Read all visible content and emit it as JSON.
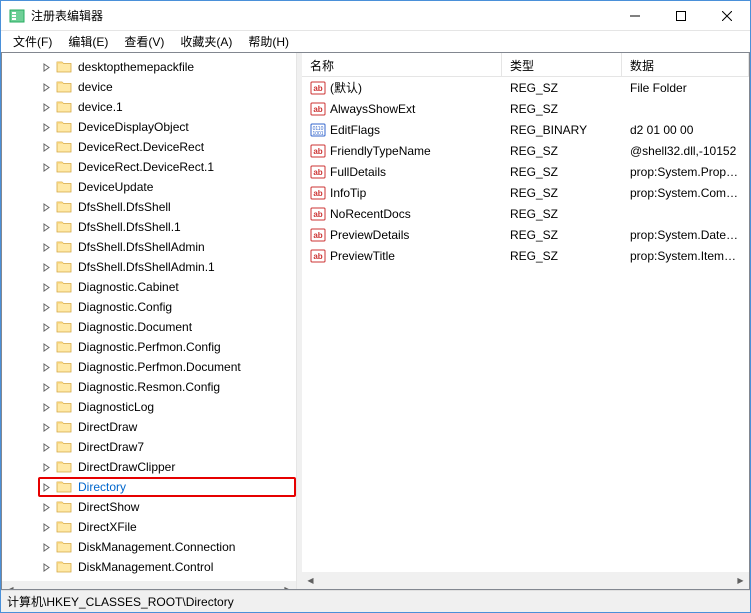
{
  "window": {
    "title": "注册表编辑器"
  },
  "menu": {
    "file": "文件(F)",
    "edit": "编辑(E)",
    "view": "查看(V)",
    "favorites": "收藏夹(A)",
    "help": "帮助(H)"
  },
  "tree": {
    "items": [
      {
        "label": "desktopthemepackfile",
        "expandable": true
      },
      {
        "label": "device",
        "expandable": true
      },
      {
        "label": "device.1",
        "expandable": true
      },
      {
        "label": "DeviceDisplayObject",
        "expandable": true
      },
      {
        "label": "DeviceRect.DeviceRect",
        "expandable": true
      },
      {
        "label": "DeviceRect.DeviceRect.1",
        "expandable": true
      },
      {
        "label": "DeviceUpdate",
        "expandable": false
      },
      {
        "label": "DfsShell.DfsShell",
        "expandable": true
      },
      {
        "label": "DfsShell.DfsShell.1",
        "expandable": true
      },
      {
        "label": "DfsShell.DfsShellAdmin",
        "expandable": true
      },
      {
        "label": "DfsShell.DfsShellAdmin.1",
        "expandable": true
      },
      {
        "label": "Diagnostic.Cabinet",
        "expandable": true
      },
      {
        "label": "Diagnostic.Config",
        "expandable": true
      },
      {
        "label": "Diagnostic.Document",
        "expandable": true
      },
      {
        "label": "Diagnostic.Perfmon.Config",
        "expandable": true
      },
      {
        "label": "Diagnostic.Perfmon.Document",
        "expandable": true
      },
      {
        "label": "Diagnostic.Resmon.Config",
        "expandable": true
      },
      {
        "label": "DiagnosticLog",
        "expandable": true
      },
      {
        "label": "DirectDraw",
        "expandable": true
      },
      {
        "label": "DirectDraw7",
        "expandable": true
      },
      {
        "label": "DirectDrawClipper",
        "expandable": true
      },
      {
        "label": "Directory",
        "expandable": true,
        "selected": true,
        "highlighted": true
      },
      {
        "label": "DirectShow",
        "expandable": true
      },
      {
        "label": "DirectXFile",
        "expandable": true
      },
      {
        "label": "DiskManagement.Connection",
        "expandable": true
      },
      {
        "label": "DiskManagement.Control",
        "expandable": true
      }
    ]
  },
  "list": {
    "columns": {
      "name": "名称",
      "type": "类型",
      "data": "数据"
    },
    "rows": [
      {
        "icon": "string",
        "name": "(默认)",
        "type": "REG_SZ",
        "data": "File Folder"
      },
      {
        "icon": "string",
        "name": "AlwaysShowExt",
        "type": "REG_SZ",
        "data": ""
      },
      {
        "icon": "binary",
        "name": "EditFlags",
        "type": "REG_BINARY",
        "data": "d2 01 00 00"
      },
      {
        "icon": "string",
        "name": "FriendlyTypeName",
        "type": "REG_SZ",
        "data": "@shell32.dll,-10152"
      },
      {
        "icon": "string",
        "name": "FullDetails",
        "type": "REG_SZ",
        "data": "prop:System.PropGrou"
      },
      {
        "icon": "string",
        "name": "InfoTip",
        "type": "REG_SZ",
        "data": "prop:System.Comment"
      },
      {
        "icon": "string",
        "name": "NoRecentDocs",
        "type": "REG_SZ",
        "data": ""
      },
      {
        "icon": "string",
        "name": "PreviewDetails",
        "type": "REG_SZ",
        "data": "prop:System.DateMod"
      },
      {
        "icon": "string",
        "name": "PreviewTitle",
        "type": "REG_SZ",
        "data": "prop:System.ItemNam"
      }
    ]
  },
  "statusbar": {
    "path": "计算机\\HKEY_CLASSES_ROOT\\Directory"
  }
}
